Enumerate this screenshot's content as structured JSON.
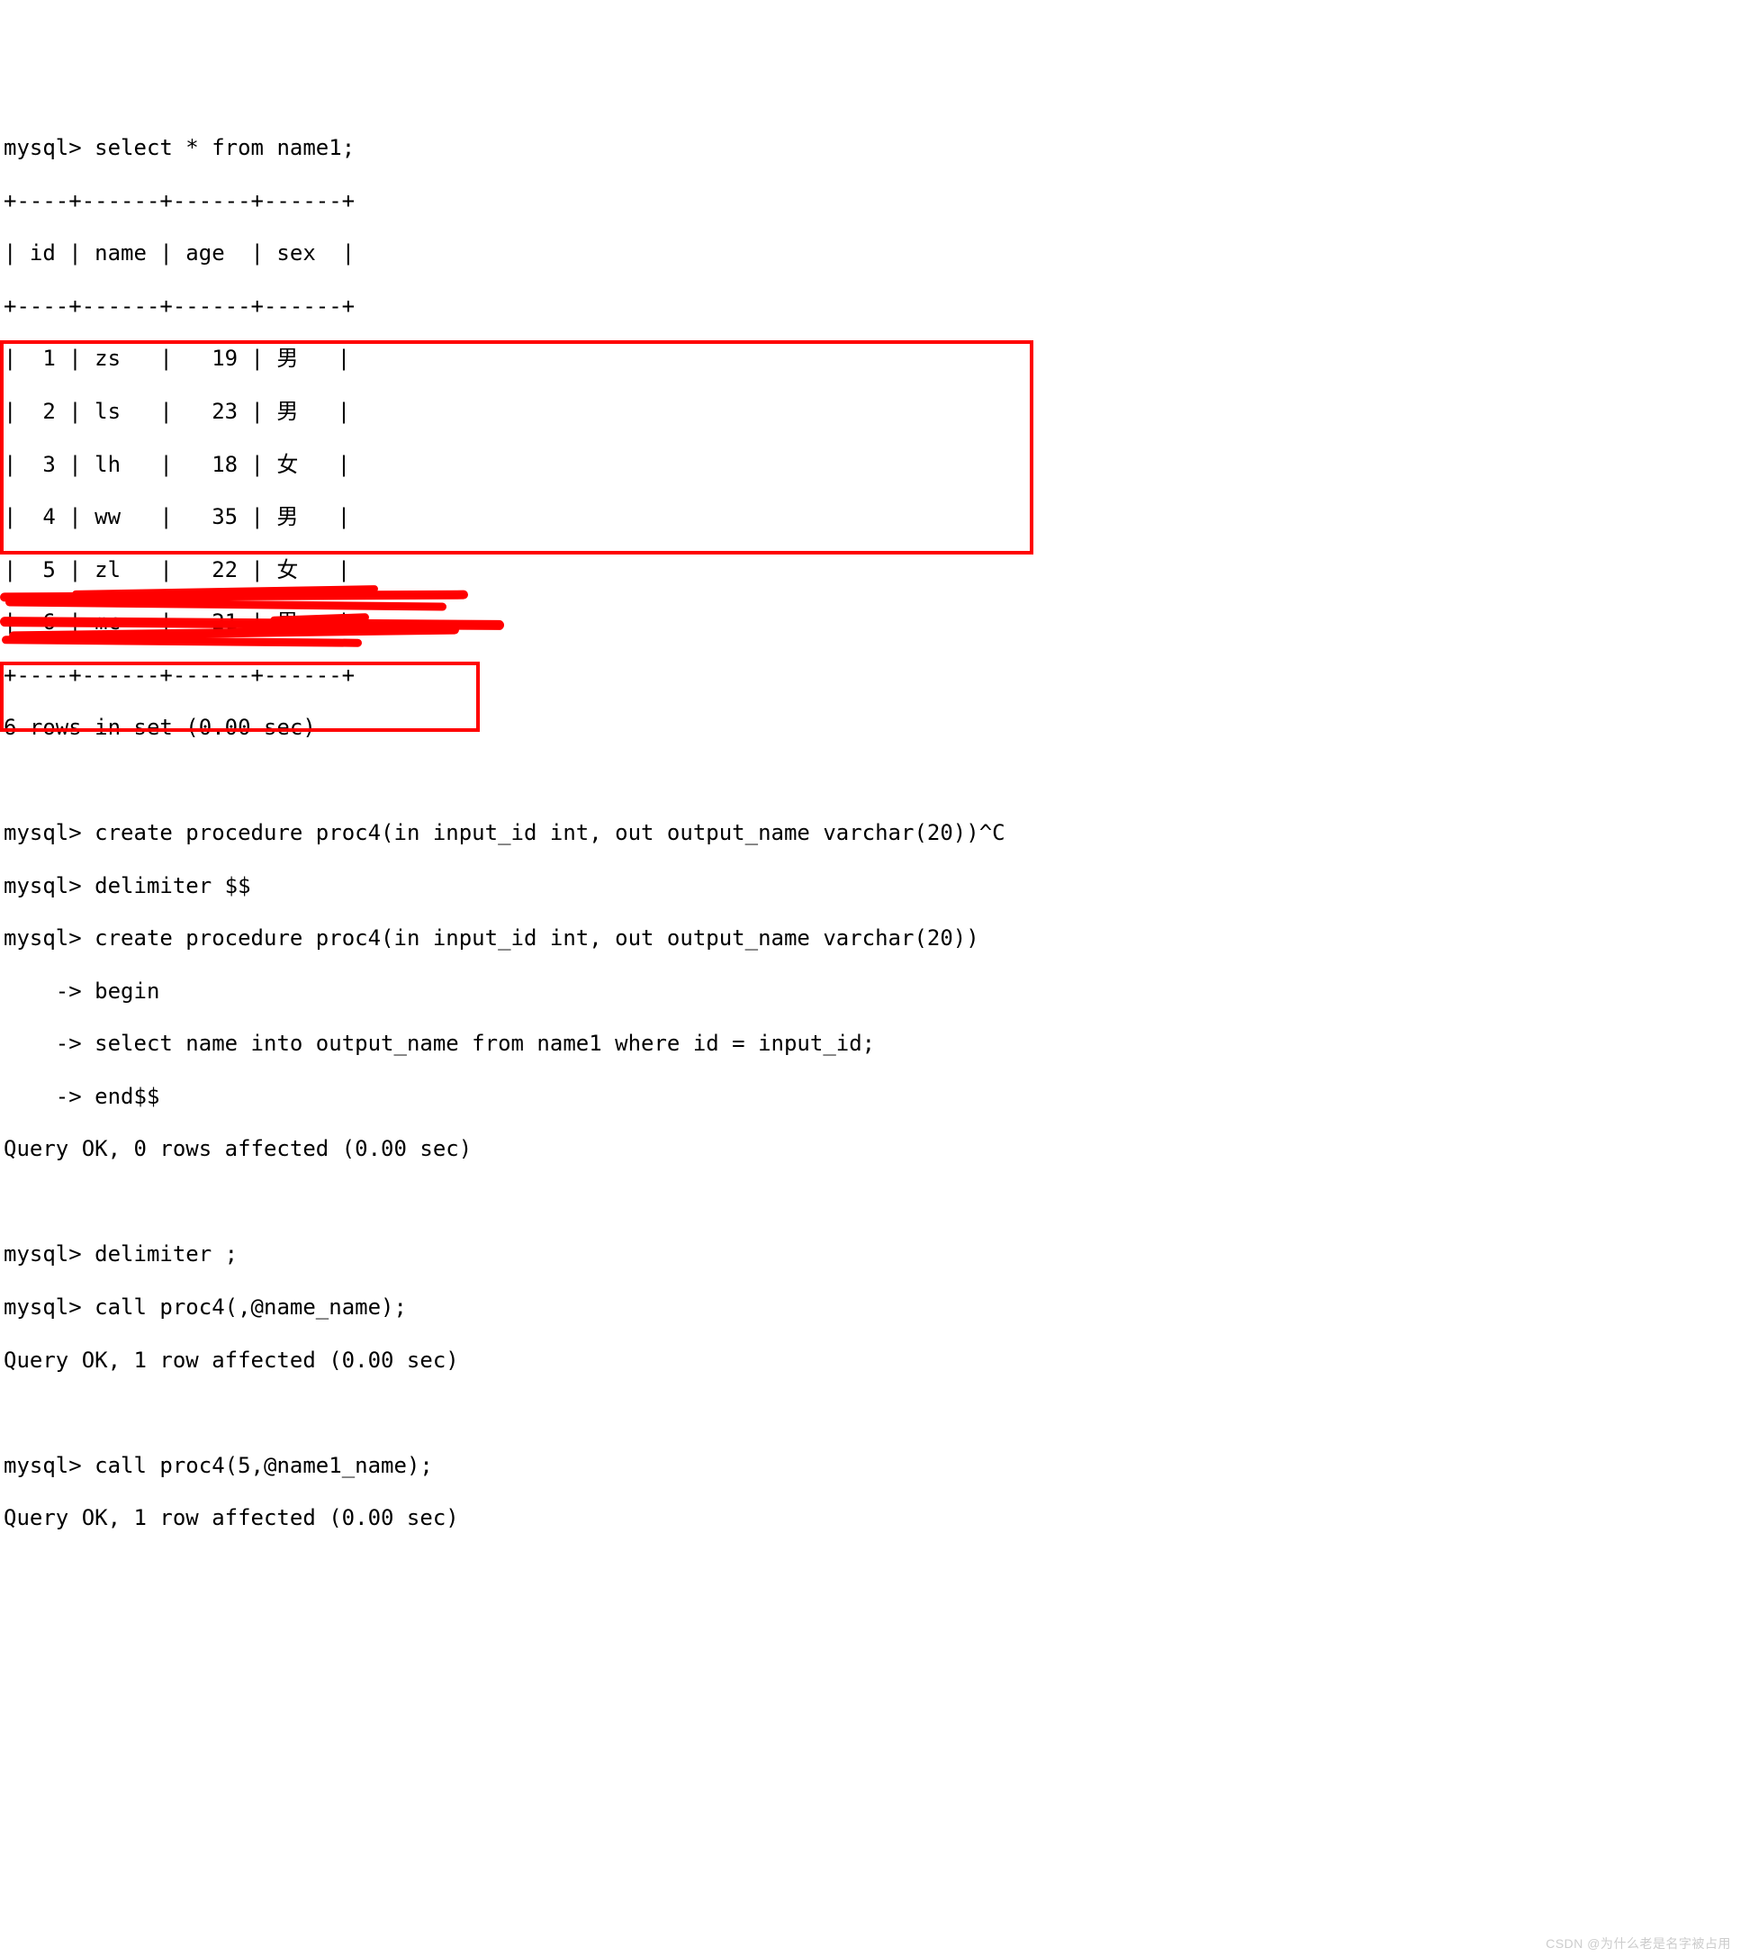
{
  "prompt": "mysql>",
  "continuation_prompt": "    ->",
  "query1": "select * from name1;",
  "table": {
    "border_top": "+----+------+------+------+",
    "header": "| id | name | age  | sex  |",
    "border_mid": "+----+------+------+------+",
    "rows": [
      "|  1 | zs   |   19 | 男   |",
      "|  2 | ls   |   23 | 男   |",
      "|  3 | lh   |   18 | 女   |",
      "|  4 | ww   |   35 | 男   |",
      "|  5 | zl   |   22 | 女   |",
      "|  6 | mc   |   21 | 男   |"
    ],
    "border_bot": "+----+------+------+------+",
    "footer": "6 rows in set (0.00 sec)"
  },
  "block1": {
    "l1": "create procedure proc4(in input_id int, out output_name varchar(20))^C",
    "l2": "delimiter $$",
    "l3": "create procedure proc4(in input_id int, out output_name varchar(20))",
    "l4": "begin",
    "l5": "select name into output_name from name1 where id = input_id;",
    "l6": "end$$",
    "result": "Query OK, 0 rows affected (0.00 sec)"
  },
  "block2": {
    "l1": "delimiter ;"
  },
  "scribbled": {
    "l1_prefix": "mysql> call proc4(",
    "l1_suffix": ",@name_name);",
    "l2": "Query OK, 1 row affected (0.00 sec)"
  },
  "block3": {
    "l1": "call proc4(5,@name1_name);",
    "result": "Query OK, 1 row affected (0.00 sec)"
  },
  "watermark": "CSDN @为什么老是名字被占用"
}
